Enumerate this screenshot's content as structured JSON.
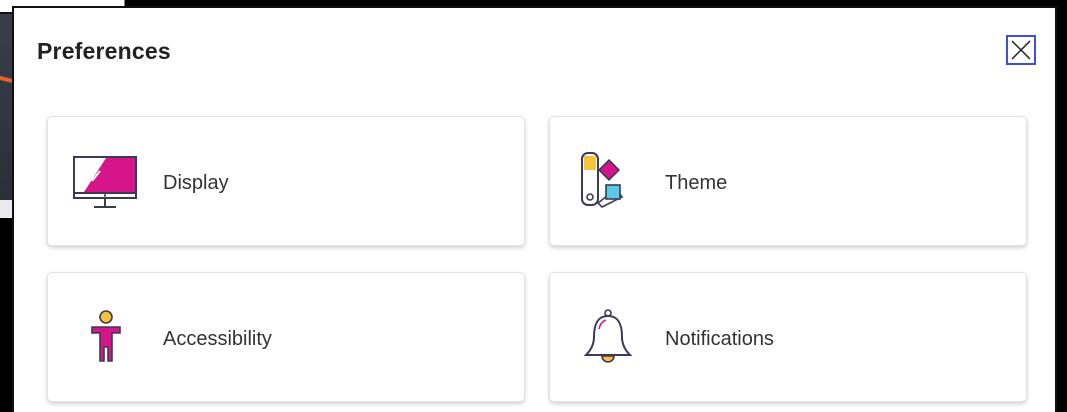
{
  "dialog": {
    "title": "Preferences",
    "close_icon": "close-icon"
  },
  "cards": [
    {
      "label": "Display",
      "icon": "monitor-icon"
    },
    {
      "label": "Theme",
      "icon": "color-palette-icon"
    },
    {
      "label": "Accessibility",
      "icon": "accessibility-person-icon"
    },
    {
      "label": "Notifications",
      "icon": "bell-icon"
    }
  ],
  "colors": {
    "accent_magenta": "#d6158a",
    "close_border": "#3b4fd8",
    "annotation_arrow": "#e2622a",
    "yellow": "#f6c33c",
    "cyan": "#5ac8e6"
  }
}
